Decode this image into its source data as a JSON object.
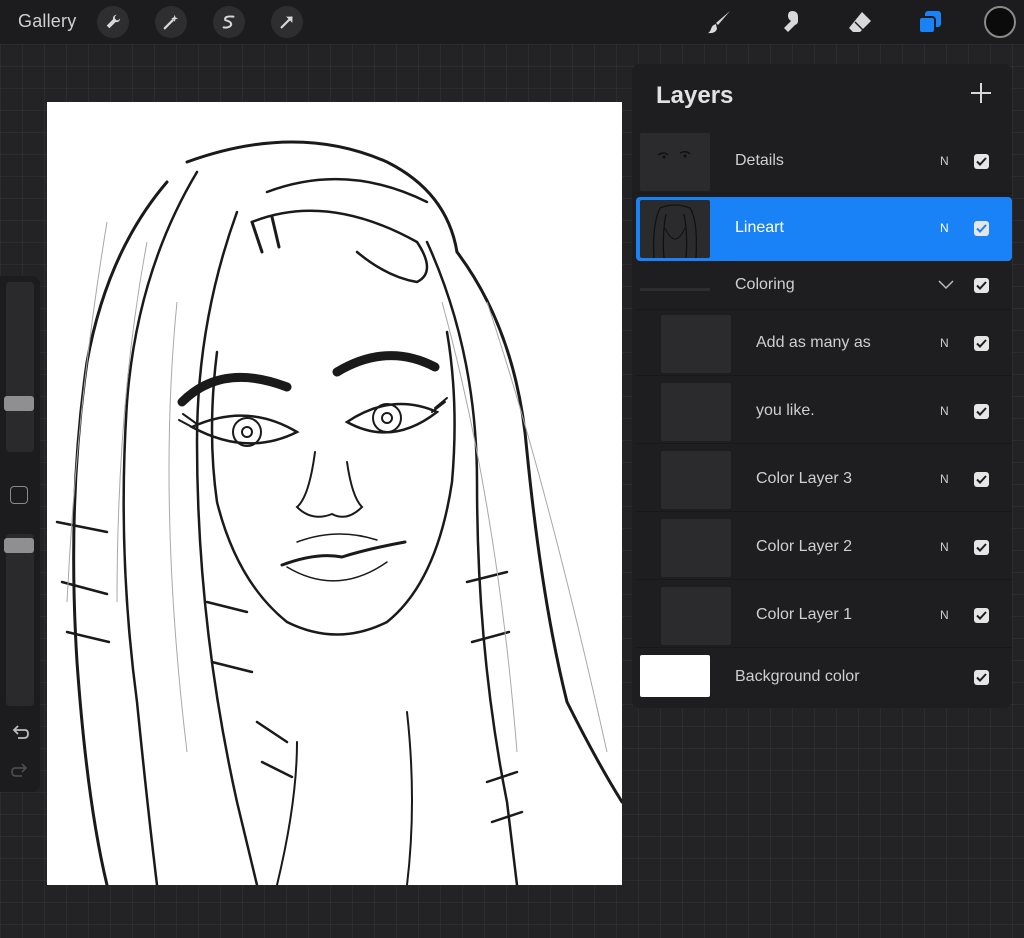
{
  "toolbar": {
    "gallery_label": "Gallery",
    "left_tools": [
      "wrench-icon",
      "magic-wand-icon",
      "selection-icon",
      "transform-arrow-icon"
    ],
    "right_tools": [
      "brush-icon",
      "smudge-icon",
      "eraser-icon",
      "layers-icon"
    ],
    "active_tool": "layers-icon",
    "accent_color": "#1a82f7",
    "current_color": "#0b0b0b"
  },
  "sidebar": {
    "brush_size": 0.25,
    "opacity": 0.05
  },
  "layers": {
    "title": "Layers",
    "items": [
      {
        "name": "Details",
        "blend": "N",
        "visible": true,
        "active": false,
        "thumb": "sketch"
      },
      {
        "name": "Lineart",
        "blend": "N",
        "visible": true,
        "active": true,
        "thumb": "lineart"
      },
      {
        "name": "Coloring",
        "blend": "",
        "visible": true,
        "active": false,
        "thumb": "group"
      },
      {
        "name": "Add as many as",
        "blend": "N",
        "visible": true,
        "active": false,
        "thumb": "empty"
      },
      {
        "name": "you like.",
        "blend": "N",
        "visible": true,
        "active": false,
        "thumb": "empty"
      },
      {
        "name": "Color Layer 3",
        "blend": "N",
        "visible": true,
        "active": false,
        "thumb": "empty"
      },
      {
        "name": "Color Layer 2",
        "blend": "N",
        "visible": true,
        "active": false,
        "thumb": "empty"
      },
      {
        "name": "Color Layer 1",
        "blend": "N",
        "visible": true,
        "active": false,
        "thumb": "empty"
      },
      {
        "name": "Background color",
        "blend": "",
        "visible": true,
        "active": false,
        "thumb": "white"
      }
    ]
  }
}
